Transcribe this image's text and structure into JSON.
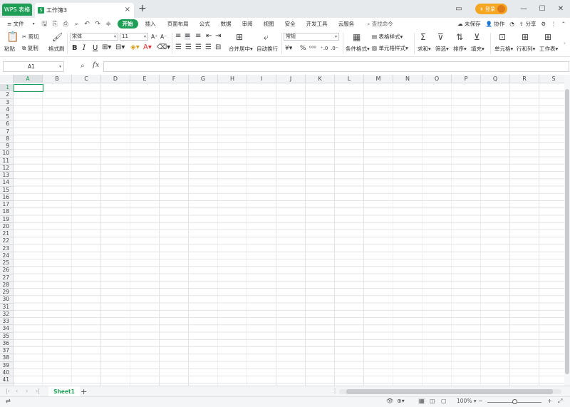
{
  "titlebar": {
    "app_tab": "WPS 表格",
    "doc_tab": "工作簿3",
    "new_tab": "+",
    "login_label": "+ 登录",
    "win_controls": [
      "restore-icon",
      "minimize-icon",
      "maximize-icon",
      "close-icon"
    ]
  },
  "menubar": {
    "file": "≡ 文件",
    "tabs": [
      "开始",
      "插入",
      "页面布局",
      "公式",
      "数据",
      "审阅",
      "视图",
      "安全",
      "开发工具",
      "云服务"
    ],
    "active_tab": "开始",
    "search": "查找命令",
    "unsaved": "未保存",
    "collaborate": "协作",
    "share": "分享"
  },
  "ribbon": {
    "paste": "粘贴",
    "cut": "剪切",
    "copy": "复制",
    "format_painter": "格式刷",
    "font_name": "宋体",
    "font_size": "11",
    "bold": "B",
    "italic": "I",
    "underline": "U",
    "merge_center": "合并居中",
    "wrap_text": "自动换行",
    "number_format": "常规",
    "percent": "%",
    "conditional_format": "条件格式",
    "table_style": "表格样式",
    "cell_style": "单元格样式",
    "sum": "求和",
    "filter": "筛选",
    "sort": "排序",
    "fill": "填充",
    "cell": "单元格",
    "row_col": "行和列",
    "worksheet": "工作表",
    "accent_color": "#1e9e57"
  },
  "formulabar": {
    "name_box": "A1",
    "fx": "fx",
    "formula": ""
  },
  "grid": {
    "columns": [
      "A",
      "B",
      "C",
      "D",
      "E",
      "F",
      "G",
      "H",
      "I",
      "J",
      "K",
      "L",
      "M",
      "N",
      "O",
      "P",
      "Q",
      "R",
      "S"
    ],
    "rows": [
      "1",
      "2",
      "3",
      "4",
      "5",
      "6",
      "7",
      "8",
      "9",
      "10",
      "11",
      "12",
      "13",
      "14",
      "15",
      "16",
      "17",
      "18",
      "19",
      "20",
      "21",
      "22",
      "23",
      "24",
      "25",
      "26",
      "27",
      "28",
      "29",
      "30",
      "31",
      "32",
      "33",
      "34",
      "35",
      "36",
      "37",
      "38",
      "39",
      "40",
      "41"
    ],
    "active_cell": "A1"
  },
  "sheetbar": {
    "sheets": [
      "Sheet1"
    ],
    "add": "+"
  },
  "statusbar": {
    "zoom": "100%"
  }
}
